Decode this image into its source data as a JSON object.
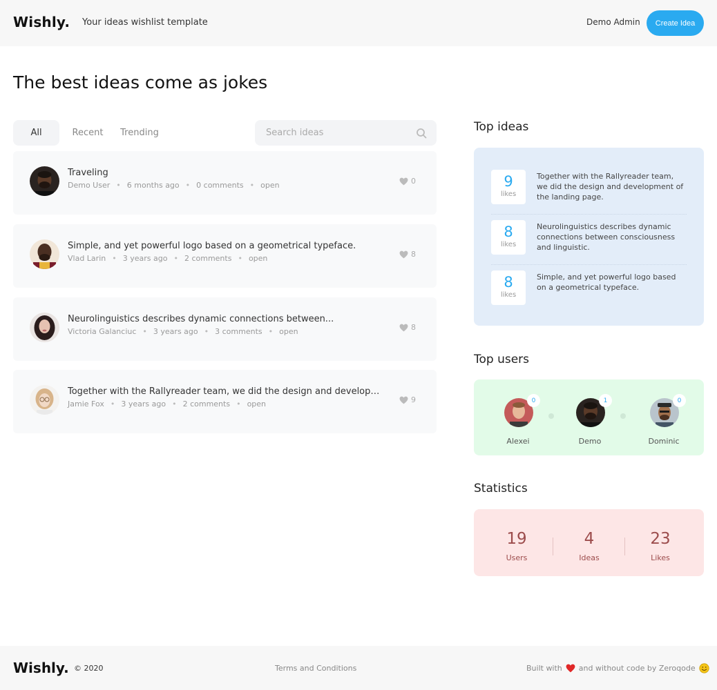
{
  "header": {
    "logo": "Wishly.",
    "tagline": "Your ideas wishlist template",
    "user": "Demo Admin",
    "create_label": "Create Idea"
  },
  "page_title": "The best ideas come as jokes",
  "tabs": [
    {
      "label": "All",
      "active": true
    },
    {
      "label": "Recent",
      "active": false
    },
    {
      "label": "Trending",
      "active": false
    }
  ],
  "search": {
    "placeholder": "Search ideas"
  },
  "ideas": [
    {
      "title": "Traveling",
      "author": "Demo User",
      "time": "6 months ago",
      "comments": "0 comments",
      "status": "open",
      "likes": "0"
    },
    {
      "title": "Simple, and yet powerful logo based on a geometrical typeface.",
      "author": "Vlad Larin",
      "time": "3 years ago",
      "comments": "2 comments",
      "status": "open",
      "likes": "8"
    },
    {
      "title": "Neurolinguistics describes dynamic connections between...",
      "author": "Victoria  Galanciuc",
      "time": "3 years ago",
      "comments": "3 comments",
      "status": "open",
      "likes": "8"
    },
    {
      "title": "Together with the Rallyreader team, we did the design and development...",
      "author": "Jamie Fox",
      "time": "3 years ago",
      "comments": "2 comments",
      "status": "open",
      "likes": "9"
    }
  ],
  "top_ideas": {
    "heading": "Top ideas",
    "items": [
      {
        "likes": "9",
        "likes_label": "likes",
        "text": "Together with the Rallyreader team, we did the design and development of the landing page."
      },
      {
        "likes": "8",
        "likes_label": "likes",
        "text": "Neurolinguistics describes dynamic connections between consciousness and linguistic."
      },
      {
        "likes": "8",
        "likes_label": "likes",
        "text": "Simple, and yet powerful logo based on a geometrical typeface."
      }
    ]
  },
  "top_users": {
    "heading": "Top users",
    "items": [
      {
        "name": "Alexei",
        "count": "0"
      },
      {
        "name": "Demo",
        "count": "1"
      },
      {
        "name": "Dominic",
        "count": "0"
      }
    ]
  },
  "statistics": {
    "heading": "Statistics",
    "items": [
      {
        "value": "19",
        "label": "Users"
      },
      {
        "value": "4",
        "label": "Ideas"
      },
      {
        "value": "23",
        "label": "Likes"
      }
    ]
  },
  "footer": {
    "logo": "Wishly.",
    "copyright": "© 2020",
    "terms": "Terms and Conditions",
    "built_prefix": "Built with",
    "built_suffix": "and without code by Zeroqode"
  },
  "colors": {
    "accent": "#2aaaf0",
    "top_ideas_bg": "#e3edf9",
    "top_users_bg": "#e2fbe8",
    "stats_bg": "#fde6e6",
    "stats_text": "#9c4c4c",
    "heart": "#e02828"
  },
  "icons": [
    "search-icon",
    "heart-icon",
    "smiley-icon"
  ]
}
